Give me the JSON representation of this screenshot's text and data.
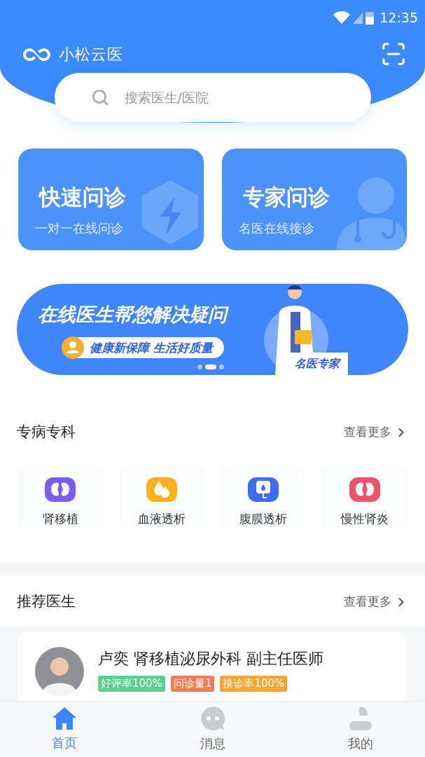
{
  "status_bar": {
    "time": "12:35"
  },
  "header": {
    "app_name": "小松云医"
  },
  "search": {
    "placeholder": "搜索医生/医院"
  },
  "consult_cards": [
    {
      "kind": "quick",
      "title": "快速问诊",
      "subtitle": "一对一在线问诊"
    },
    {
      "kind": "expert",
      "title": "专家问诊",
      "subtitle": "名医在线接诊"
    }
  ],
  "banner": {
    "title": "在线医生帮您解决疑问",
    "tagline": "健康新保障 生活好质量",
    "badge": "名医专家",
    "dots": [
      {
        "selected": false
      },
      {
        "selected": true
      },
      {
        "selected": false
      }
    ]
  },
  "specialties": {
    "title": "专病专科",
    "more": "查看更多",
    "items": [
      {
        "kind": "kidney",
        "label": "肾移植",
        "color": "#7a5cf2"
      },
      {
        "kind": "drops",
        "label": "血液透析",
        "color": "#fbb21c"
      },
      {
        "kind": "bag",
        "label": "腹膜透析",
        "color": "#3f6cf0"
      },
      {
        "kind": "kidney",
        "label": "慢性肾炎",
        "color": "#f0526a"
      }
    ]
  },
  "doctors": {
    "title": "推荐医生",
    "more": "查看更多",
    "items": [
      {
        "name_line": "卢奕 肾移植泌尿外科 副主任医师",
        "tags": [
          {
            "text": "好评率100%",
            "color": "#5ccf8c"
          },
          {
            "text": "问诊量1",
            "color": "#f27c58"
          },
          {
            "text": "接诊率100%",
            "color": "#f6a533"
          }
        ]
      }
    ]
  },
  "tab_bar": [
    {
      "kind": "home",
      "label": "首页",
      "selected": true
    },
    {
      "kind": "message",
      "label": "消息",
      "selected": false
    },
    {
      "kind": "profile",
      "label": "我的",
      "selected": false
    }
  ]
}
